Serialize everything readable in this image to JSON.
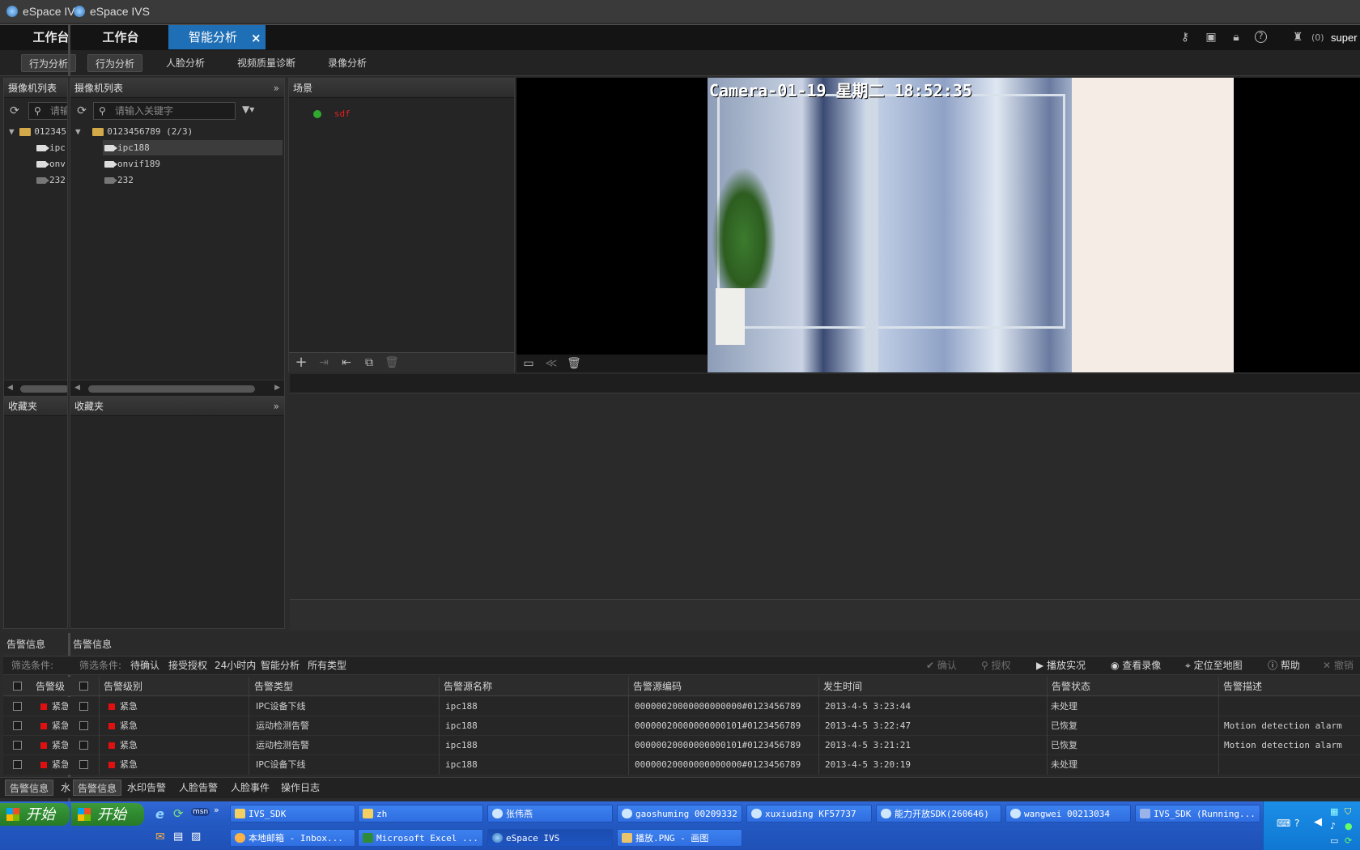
{
  "window": {
    "back_title": "eSpace IV",
    "title": "eSpace IVS"
  },
  "nav": {
    "back_tab": "工作台",
    "tab_workbench": "工作台",
    "tab_intelligent": "智能分析",
    "close_glyph": "×",
    "user_count": "(0)",
    "user_name": "super"
  },
  "subnav": {
    "back_active": "行为分析",
    "tabs": [
      "行为分析",
      "人脸分析",
      "视频质量诊断",
      "录像分析"
    ]
  },
  "camera_panel": {
    "title": "摄像机列表",
    "search_placeholder": "请输入关键字",
    "back_search_placeholder": "请输",
    "root": "0123456789 (2/3)",
    "back_root": "012345",
    "cameras": [
      "ipc188",
      "onvif189",
      "232"
    ],
    "back_cameras": [
      "ipc",
      "onv",
      "232"
    ]
  },
  "favorites_panel": {
    "title": "收藏夹"
  },
  "scene_panel": {
    "title": "场景",
    "items": [
      {
        "label": "sdf",
        "status_color": "#2faa2f"
      }
    ]
  },
  "video": {
    "osd_text": "Camera-01-19 星期二 18:52:35"
  },
  "alarm": {
    "section_title": "告警信息",
    "filter_label": "筛选条件:",
    "back_filter_label": "筛选条件:",
    "filters": [
      "待确认",
      "接受授权",
      "24小时内",
      "智能分析",
      "所有类型"
    ],
    "toolbar": {
      "confirm": "确认",
      "authorize": "授权",
      "play_live": "播放实况",
      "view_record": "查看录像",
      "locate_map": "定位至地图",
      "help": "帮助",
      "revoke": "撤销"
    },
    "columns": [
      "告警级别",
      "告警类型",
      "告警源名称",
      "告警源编码",
      "发生时间",
      "告警状态",
      "告警描述"
    ],
    "back_column": "告警级",
    "rows": [
      {
        "level": "紧急",
        "type": "IPC设备下线",
        "source": "ipc188",
        "code": "00000020000000000000#0123456789",
        "time": "2013-4-5 3:23:44",
        "status": "未处理",
        "desc": ""
      },
      {
        "level": "紧急",
        "type": "运动检测告警",
        "source": "ipc188",
        "code": "00000020000000000101#0123456789",
        "time": "2013-4-5 3:22:47",
        "status": "已恢复",
        "desc": "Motion detection alarm"
      },
      {
        "level": "紧急",
        "type": "运动检测告警",
        "source": "ipc188",
        "code": "00000020000000000101#0123456789",
        "time": "2013-4-5 3:21:21",
        "status": "已恢复",
        "desc": "Motion detection alarm"
      },
      {
        "level": "紧急",
        "type": "IPC设备下线",
        "source": "ipc188",
        "code": "00000020000000000000#0123456789",
        "time": "2013-4-5 3:20:19",
        "status": "未处理",
        "desc": ""
      }
    ],
    "back_level": "紧急",
    "bottom_tabs": [
      "告警信息",
      "水印告警",
      "人脸告警",
      "人脸事件",
      "操作日志"
    ],
    "back_bottom_tab": "告警信息",
    "back_bottom_tab2": "水"
  },
  "taskbar": {
    "start_label": "开始",
    "row1": [
      "IVS_SDK",
      "zh",
      "张伟燕",
      "gaoshuming 00209332",
      "xuxiuding KF57737",
      "能力开放SDK(260646)",
      "wangwei 00213034",
      "IVS_SDK (Running..."
    ],
    "row2": [
      "本地邮箱 - Inbox...",
      "Microsoft Excel ...",
      "eSpace IVS",
      "播放.PNG - 画图"
    ],
    "quick_launch_msn": "msn"
  }
}
